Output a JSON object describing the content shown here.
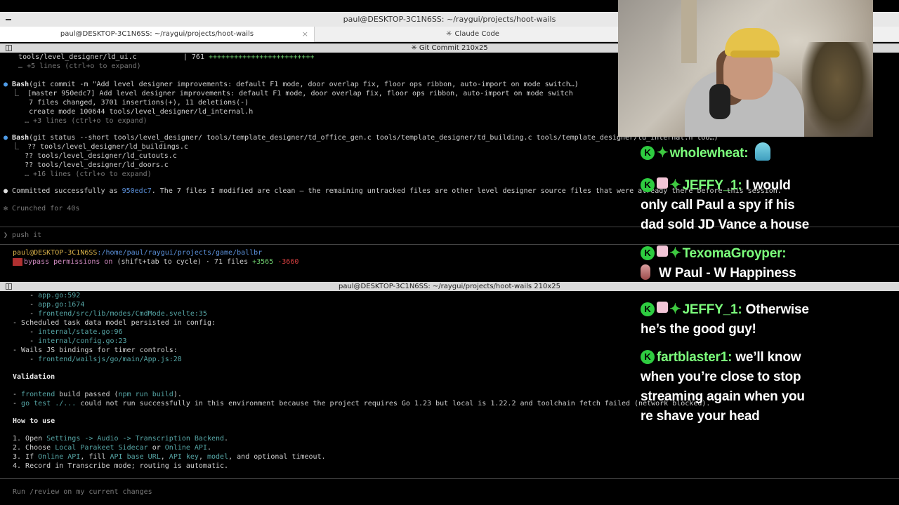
{
  "window": {
    "title": "paul@DESKTOP-3C1N6SS: ~/raygui/projects/hoot-wails"
  },
  "tabs": [
    {
      "label": "paul@DESKTOP-3C1N6SS: ~/raygui/projects/hoot-wails",
      "close": "×",
      "active": true
    },
    {
      "label": "Claude Code",
      "spark": "✳",
      "active": false
    }
  ],
  "top_pane": {
    "header": "✳ Git Commit 210x25",
    "lines": [
      {
        "a": "   tools/level_designer/ld_ui.c",
        "b": "           | 761 ",
        "c": "+++++++++++++++++++++++++"
      },
      {
        "a": "   … +5 lines (ctrl+o to expand)"
      },
      {
        "bullet": "●",
        "a": " Bash",
        "b": "(git commit -m \"Add level designer improvements: default F1 mode, door overlap fix, floor ops ribbon, auto-import on mode switch…)"
      },
      {
        "a": "  ⎿  [master 950edc7] Add level designer improvements: default F1 mode, door overlap fix, floor ops ribbon, auto-import on mode switch"
      },
      {
        "a": "      7 files changed, 3701 insertions(+), 11 deletions(-)"
      },
      {
        "a": "      create mode 100644 tools/level_designer/ld_internal.h"
      },
      {
        "a": "     … +3 lines (ctrl+o to expand)"
      },
      {
        "bullet": "●",
        "a": " Bash",
        "b": "(git status --short tools/level_designer/ tools/template_designer/td_office_gen.c tools/template_designer/td_building.c tools/template_designer/td_internal.h too…)"
      },
      {
        "a": "  ⎿  ?? tools/level_designer/ld_buildings.c"
      },
      {
        "a": "     ?? tools/level_designer/ld_cutouts.c"
      },
      {
        "a": "     ?? tools/level_designer/ld_doors.c"
      },
      {
        "a": "     … +16 lines (ctrl+o to expand)"
      },
      {
        "bullet": "●",
        "a": " Committed successfully as ",
        "hash": "950edc7",
        "b": ". The 7 files I modified are clean — the remaining untracked files are other level designer source files that were already there before this session."
      },
      {
        "a": "✻ Crunched for 40s"
      },
      {
        "a": "❯ push it"
      },
      {
        "user": "paul@DESKTOP-3C1N6SS",
        "path": ":/home/paul/raygui/projects/game/ballbr"
      },
      {
        "a": "bypass permissions on",
        "b": " (shift+tab to cycle) · 71 files ",
        "c": "+3565",
        "d": " -3660"
      }
    ]
  },
  "bottom_pane": {
    "header": "paul@DESKTOP-3C1N6SS: ~/raygui/projects/hoot-wails 210x25",
    "lines": [
      {
        "a": "    - ",
        "link": "app.go:592"
      },
      {
        "a": "    - ",
        "link": "app.go:1674"
      },
      {
        "a": "    - ",
        "link": "frontend/src/lib/modes/CmdMode.svelte:35"
      },
      {
        "a": "- Scheduled task data model persisted in config:"
      },
      {
        "a": "    - ",
        "link": "internal/state.go:96"
      },
      {
        "a": "    - ",
        "link": "internal/config.go:23"
      },
      {
        "a": "- Wails JS bindings for timer controls:"
      },
      {
        "a": "    - ",
        "link": "frontend/wailsjs/go/main/App.js:28"
      },
      {
        "heading": "Validation"
      },
      {
        "a": "- ",
        "link": "frontend",
        "b": " build passed (",
        "link2": "npm run build",
        "c": ")."
      },
      {
        "a": "- ",
        "link": "go test ./...",
        "b": " could not run successfully in this environment because the project requires Go 1.23 but local is 1.22.2 and toolchain fetch failed (network blocked)."
      },
      {
        "heading": "How to use"
      },
      {
        "a": "1. Open ",
        "link": "Settings -> Audio -> Transcription Backend",
        "b": "."
      },
      {
        "a": "2. Choose ",
        "link": "Local Parakeet Sidecar",
        "b": " or ",
        "link2": "Online API",
        "c": "."
      },
      {
        "a": "3. If ",
        "link": "Online API",
        "b": ", fill ",
        "link2": "API base URL",
        "c": ", ",
        "link3": "API key",
        "d": ", ",
        "link4": "model",
        "e": ", and optional timeout."
      },
      {
        "a": "4. Record in Transcribe mode; routing is automatic."
      }
    ],
    "prompt_placeholder": "Run /review on my current changes"
  },
  "chat": {
    "messages": [
      {
        "user": "wholewheat:",
        "text": ""
      },
      {
        "user": "JEFFY_1:",
        "text_line1": " I would",
        "text_rest": [
          "only call Paul a spy if his",
          "dad sold JD Vance a house"
        ]
      },
      {
        "user": "TexomaGroyper:",
        "text_rest": [
          "W Paul - W Happiness"
        ]
      },
      {
        "user": "JEFFY_1:",
        "text_line1": " Otherwise",
        "text_rest": [
          "he’s the good guy!"
        ]
      },
      {
        "user": "fartblaster1:",
        "text_line1": "  we’ll know",
        "text_rest": [
          "when you’re close to stop",
          "streaming again when you",
          "re shave your head"
        ]
      }
    ]
  },
  "colors": {
    "link": "#56a6a6",
    "user_green": "#6fcf6f",
    "bullet_blue": "#4f9ce8",
    "chat_badge": "#2ecc40"
  }
}
